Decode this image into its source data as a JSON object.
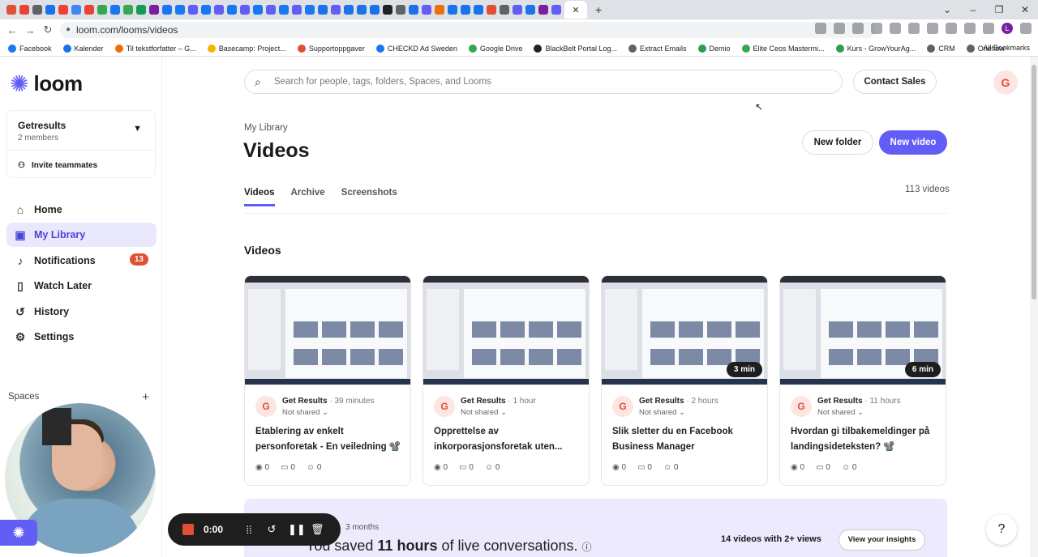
{
  "browser": {
    "url": "loom.com/looms/videos",
    "tab_close": "✕",
    "new_tab": "+",
    "bookmarks": [
      {
        "label": "Facebook",
        "color": "#1877f2"
      },
      {
        "label": "Kalender",
        "color": "#1a73e8"
      },
      {
        "label": "Til tekstforfatter – G...",
        "color": "#e8710a"
      },
      {
        "label": "Basecamp: Project...",
        "color": "#f4b400"
      },
      {
        "label": "Supportoppgaver",
        "color": "#e14f34"
      },
      {
        "label": "CHECKD Ad Sweden",
        "color": "#1877f2"
      },
      {
        "label": "Google Drive",
        "color": "#34a853"
      },
      {
        "label": "BlackBelt Portal Log...",
        "color": "#222222"
      },
      {
        "label": "Extract Emails",
        "color": "#5f6368"
      },
      {
        "label": "Demio",
        "color": "#2e9e4f"
      },
      {
        "label": "Elite Ceos Mastermi...",
        "color": "#34a853"
      },
      {
        "label": "Kurs - GrowYourAg...",
        "color": "#2e9e4f"
      },
      {
        "label": "CRM",
        "color": "#5f6368"
      },
      {
        "label": "Oneflow",
        "color": "#5f6368"
      }
    ],
    "all_bookmarks": "All Bookmarks"
  },
  "sidebar": {
    "logo": "loom",
    "workspace": {
      "name": "Getresults",
      "members": "2 members",
      "invite": "Invite teammates"
    },
    "nav": [
      {
        "label": "Home",
        "icon": "home-icon",
        "glyph": "⌂"
      },
      {
        "label": "My Library",
        "icon": "library-icon",
        "glyph": "▣"
      },
      {
        "label": "Notifications",
        "icon": "bell-icon",
        "glyph": "♪",
        "badge": "13"
      },
      {
        "label": "Watch Later",
        "icon": "bookmark-icon",
        "glyph": "▯"
      },
      {
        "label": "History",
        "icon": "history-icon",
        "glyph": "↺"
      },
      {
        "label": "Settings",
        "icon": "gear-icon",
        "glyph": "⚙"
      }
    ],
    "spaces": "Spaces"
  },
  "recorder": {
    "time": "0:00"
  },
  "header": {
    "search_placeholder": "Search for people, tags, folders, Spaces, and Looms",
    "contact_sales": "Contact Sales",
    "avatar": "G"
  },
  "library": {
    "breadcrumb": "My Library",
    "title": "Videos",
    "new_folder": "New folder",
    "new_video": "New video",
    "tabs": [
      "Videos",
      "Archive",
      "Screenshots"
    ],
    "count": "113 videos",
    "section": "Videos"
  },
  "videos": [
    {
      "owner": "Get Results",
      "age": "· 39 minutes",
      "share": "Not shared",
      "title": "Etablering av enkelt personforetak - En veiledning 📽️",
      "duration": "",
      "views": "0",
      "comments": "0",
      "reactions": "0"
    },
    {
      "owner": "Get Results",
      "age": "· 1 hour",
      "share": "Not shared",
      "title": "Opprettelse av inkorporasjonsforetak uten...",
      "duration": "",
      "views": "0",
      "comments": "0",
      "reactions": "0"
    },
    {
      "owner": "Get Results",
      "age": "· 2 hours",
      "share": "Not shared",
      "title": "Slik sletter du en Facebook Business Manager",
      "duration": "3 min",
      "views": "0",
      "comments": "0",
      "reactions": "0"
    },
    {
      "owner": "Get Results",
      "age": "· 11 hours",
      "share": "Not shared",
      "title": "Hvordan gi tilbakemeldinger på landingsideteksten? 📽️",
      "duration": "6 min",
      "views": "0",
      "comments": "0",
      "reactions": "0"
    }
  ],
  "insights": {
    "period": "3 months",
    "saved_pre": "You saved ",
    "saved_bold": "11 hours",
    "saved_post": " of live conversations.",
    "views": "14 videos with 2+ views",
    "button": "View your insights"
  },
  "help": "?"
}
